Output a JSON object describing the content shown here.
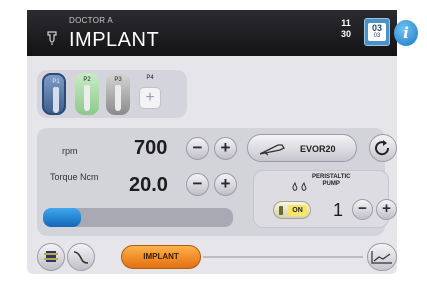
{
  "header": {
    "doctor": "DOCTOR A",
    "program": "IMPLANT",
    "time_hours": "11",
    "time_minutes": "30",
    "calendar_day": "03",
    "calendar_month": "03",
    "info_glyph": "i"
  },
  "instruments": [
    {
      "label": "P1",
      "state": "active"
    },
    {
      "label": "P2",
      "state": "available"
    },
    {
      "label": "P3",
      "state": "available"
    },
    {
      "label": "P4",
      "state": "empty",
      "add_glyph": "+"
    }
  ],
  "speed": {
    "unit_label": "rpm",
    "value": "700",
    "minus": "−",
    "plus": "+"
  },
  "torque": {
    "label": "Torque Ncm",
    "value": "20.0",
    "minus": "−",
    "plus": "+"
  },
  "handpiece": {
    "label": "EVOR20"
  },
  "pump": {
    "label_line1": "PERISTALTIC",
    "label_line2": "PUMP",
    "toggle_label": "ON",
    "level": "1",
    "minus": "−",
    "plus": "+"
  },
  "progress": {
    "fraction": 0.2
  },
  "bottom": {
    "mode_label": "IMPLANT"
  },
  "colors": {
    "header_bg": "#1a1a1e",
    "accent_blue": "#1b79c0",
    "implant_orange": "#f08a20",
    "pump_on_yellow": "#f5e66a"
  },
  "icons": [
    "faucet-icon",
    "calendar-icon",
    "info-icon",
    "handpiece-icon",
    "reverse-rotation-icon",
    "water-drops-icon",
    "motor-icon",
    "tube-icon",
    "graph-icon"
  ]
}
